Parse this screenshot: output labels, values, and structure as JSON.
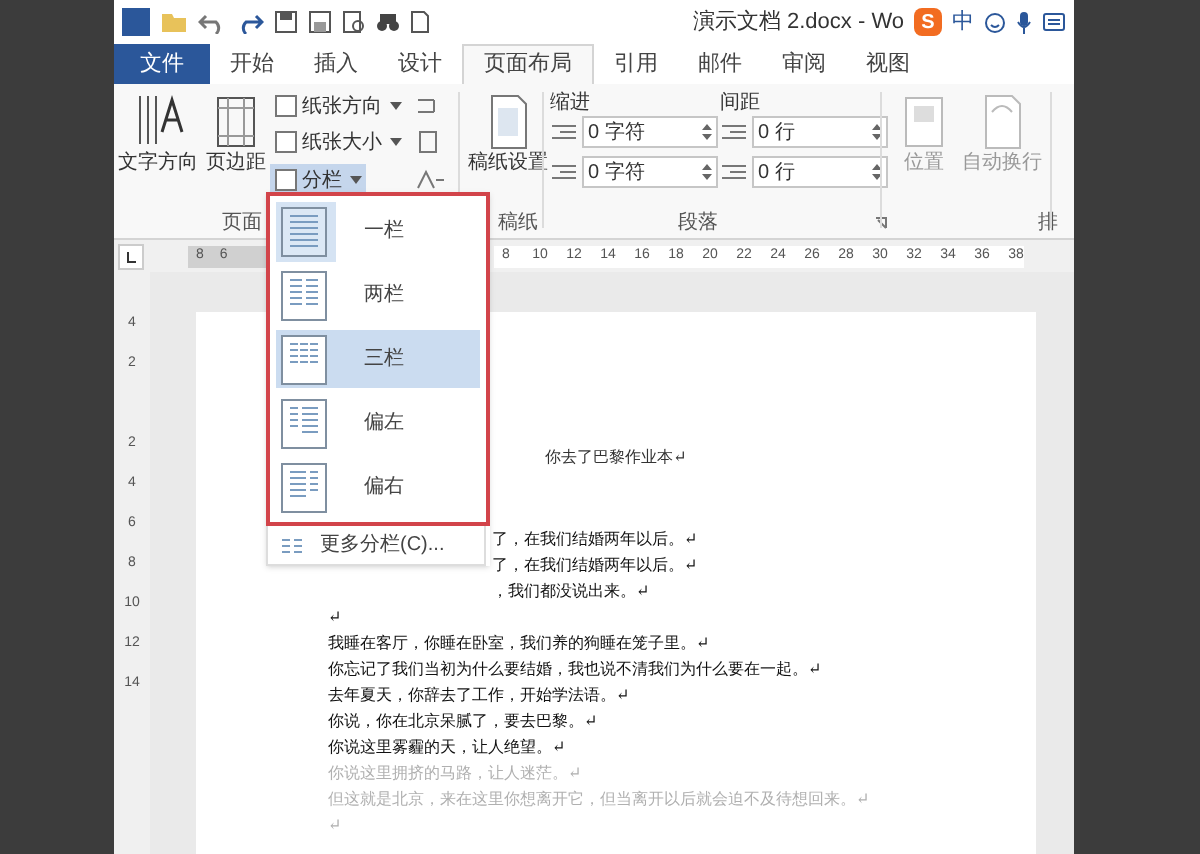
{
  "window": {
    "title": "演示文档 2.docx - Wo",
    "ime": {
      "logo": "S",
      "mode": "中"
    }
  },
  "tabs": [
    {
      "label": "文件",
      "selected": false,
      "kind": "file"
    },
    {
      "label": "开始",
      "selected": false,
      "kind": "tab"
    },
    {
      "label": "插入",
      "selected": false,
      "kind": "tab"
    },
    {
      "label": "设计",
      "selected": false,
      "kind": "tab"
    },
    {
      "label": "页面布局",
      "selected": true,
      "kind": "tab"
    },
    {
      "label": "引用",
      "selected": false,
      "kind": "tab"
    },
    {
      "label": "邮件",
      "selected": false,
      "kind": "tab"
    },
    {
      "label": "审阅",
      "selected": false,
      "kind": "tab"
    },
    {
      "label": "视图",
      "selected": false,
      "kind": "tab"
    }
  ],
  "ribbon": {
    "text_direction": "文字方向",
    "margins": "页边距",
    "orientation": "纸张方向",
    "size": "纸张大小",
    "columns": {
      "label": "分栏",
      "expanded": true
    },
    "draft_paper": "稿纸设置",
    "indent": {
      "label": "缩进",
      "left": "0 字符",
      "right": "0 字符"
    },
    "spacing": {
      "label": "间距",
      "before": "0 行",
      "after": "0 行"
    },
    "position": "位置",
    "wrap": "自动换行",
    "groups": [
      "页面",
      "稿纸",
      "段落",
      "排"
    ]
  },
  "ruler": {
    "left_ticks": [
      "8",
      "6"
    ],
    "ticks": [
      "8",
      "10",
      "12",
      "14",
      "16",
      "18",
      "20",
      "22",
      "24",
      "26",
      "28",
      "30",
      "32",
      "34",
      "36",
      "38"
    ],
    "vertical_ticks": [
      "4",
      "2",
      "2",
      "4",
      "6",
      "8",
      "10",
      "12",
      "14"
    ]
  },
  "columns_menu": {
    "items": [
      {
        "label": "一栏",
        "selected": true,
        "highlighted": false,
        "kind": "one"
      },
      {
        "label": "两栏",
        "selected": false,
        "highlighted": false,
        "kind": "two"
      },
      {
        "label": "三栏",
        "selected": false,
        "highlighted": true,
        "kind": "three"
      },
      {
        "label": "偏左",
        "selected": false,
        "highlighted": false,
        "kind": "left"
      },
      {
        "label": "偏右",
        "selected": false,
        "highlighted": false,
        "kind": "right"
      }
    ],
    "more": "更多分栏(C)..."
  },
  "document": {
    "title": "你去了巴黎作业本↵",
    "lines_beside_menu": [
      "了，在我们结婚两年以后。↵",
      "了，在我们结婚两年以后。↵",
      "，我们都没说出来。↵"
    ],
    "lines": [
      {
        "text": "↵",
        "faded": false
      },
      {
        "text": "我睡在客厅，你睡在卧室，我们养的狗睡在笼子里。↵",
        "faded": false
      },
      {
        "text": "你忘记了我们当初为什么要结婚，我也说不清我们为什么要在一起。↵",
        "faded": false
      },
      {
        "text": "去年夏天，你辞去了工作，开始学法语。↵",
        "faded": false
      },
      {
        "text": "你说，你在北京呆腻了，要去巴黎。↵",
        "faded": false
      },
      {
        "text": "你说这里雾霾的天，让人绝望。↵",
        "faded": false
      },
      {
        "text": "你说这里拥挤的马路，让人迷茫。↵",
        "faded": true
      },
      {
        "text": "但这就是北京，来在这里你想离开它，但当离开以后就会迫不及待想回来。↵",
        "faded": true
      },
      {
        "text": "↵",
        "faded": true
      }
    ]
  }
}
